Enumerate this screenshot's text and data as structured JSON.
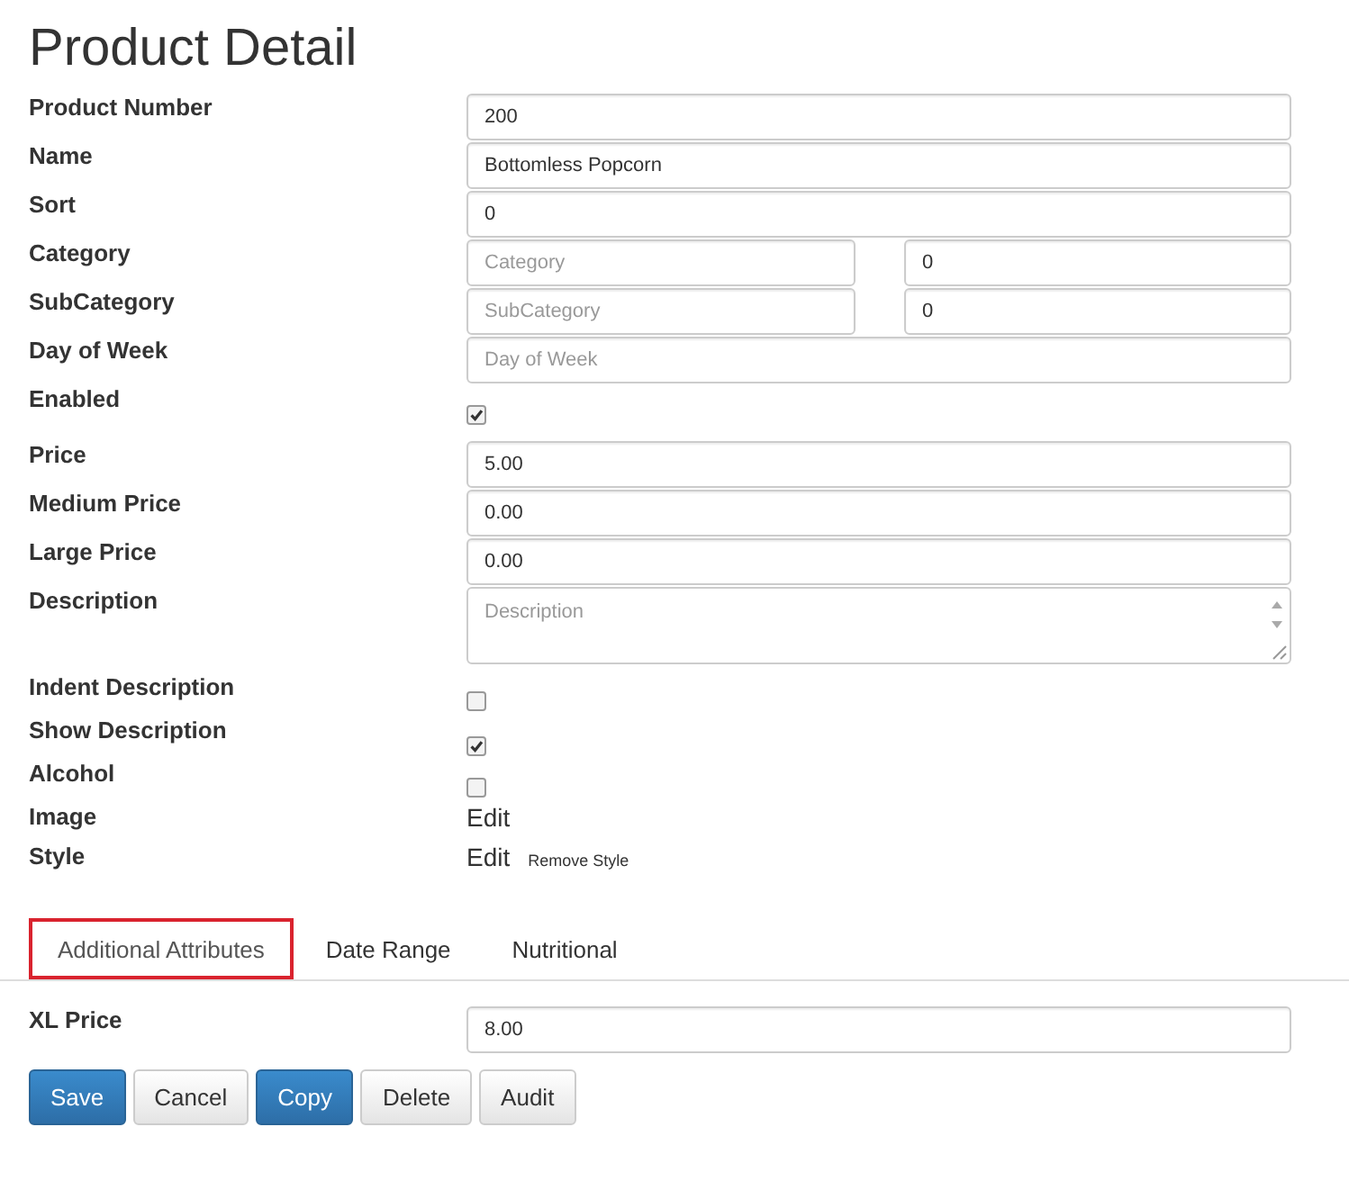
{
  "title": "Product Detail",
  "fields": [
    {
      "label": "Product Number",
      "kind": "text",
      "value": "200"
    },
    {
      "label": "Name",
      "kind": "text",
      "value": "Bottomless Popcorn"
    },
    {
      "label": "Sort",
      "kind": "text",
      "value": "0"
    },
    {
      "label": "Category",
      "kind": "split",
      "placeholder": "Category",
      "value": "0"
    },
    {
      "label": "SubCategory",
      "kind": "split",
      "placeholder": "SubCategory",
      "value": "0"
    },
    {
      "label": "Day of Week",
      "kind": "text",
      "placeholder": "Day of Week"
    },
    {
      "label": "Enabled",
      "kind": "checkbox",
      "checked": true
    },
    {
      "label": "Price",
      "kind": "text",
      "value": "5.00"
    },
    {
      "label": "Medium Price",
      "kind": "text",
      "value": "0.00"
    },
    {
      "label": "Large Price",
      "kind": "text",
      "value": "0.00"
    },
    {
      "label": "Description",
      "kind": "textarea",
      "placeholder": "Description"
    },
    {
      "label": "Indent Description",
      "kind": "checkbox",
      "checked": false
    },
    {
      "label": "Show Description",
      "kind": "checkbox",
      "checked": true
    },
    {
      "label": "Alcohol",
      "kind": "checkbox",
      "checked": false
    },
    {
      "label": "Image",
      "kind": "links",
      "link": "Edit"
    },
    {
      "label": "Style",
      "kind": "links",
      "link": "Edit",
      "extra": "Remove Style"
    }
  ],
  "tabs": [
    {
      "label": "Additional Attributes",
      "selected": true
    },
    {
      "label": "Date Range",
      "selected": false
    },
    {
      "label": "Nutritional",
      "selected": false
    }
  ],
  "tab_fields": [
    {
      "label": "XL Price",
      "kind": "text",
      "value": "8.00"
    }
  ],
  "buttons": [
    {
      "label": "Save",
      "kind": "primary"
    },
    {
      "label": "Cancel",
      "kind": "default"
    },
    {
      "label": "Copy",
      "kind": "primary"
    },
    {
      "label": "Delete",
      "kind": "default"
    },
    {
      "label": "Audit",
      "kind": "default"
    }
  ]
}
